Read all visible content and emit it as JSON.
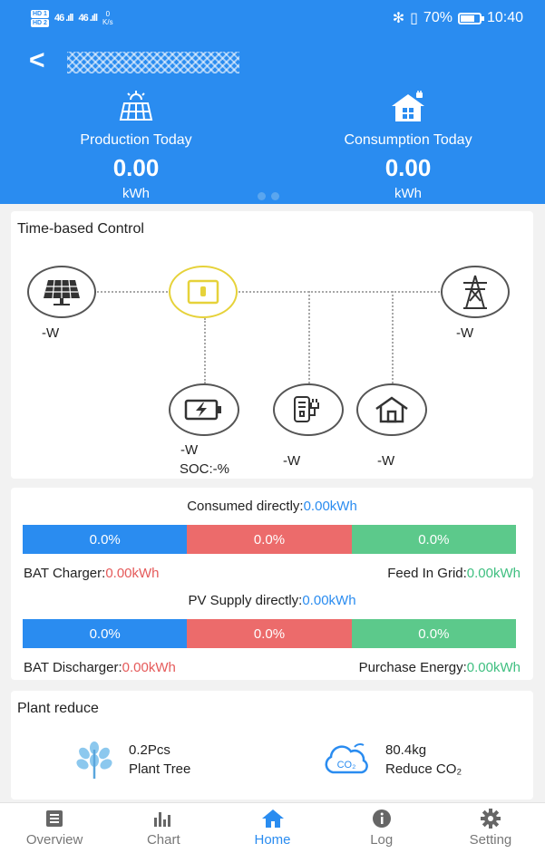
{
  "status_bar": {
    "net1": "HD 1",
    "net2": "HD 2",
    "signal1": "46 .ıll",
    "signal2": "46 .ıll",
    "speed_value": "0",
    "speed_unit": "K/s",
    "battery_pct": "70%",
    "time": "10:40"
  },
  "header": {
    "production": {
      "label": "Production Today",
      "value": "0.00",
      "unit": "kWh"
    },
    "consumption": {
      "label": "Consumption Today",
      "value": "0.00",
      "unit": "kWh"
    }
  },
  "flow": {
    "title": "Time-based Control",
    "pv": "-W",
    "grid": "-W",
    "battery": "-W",
    "soc": "SOC:-%",
    "charger": "-W",
    "home": "-W"
  },
  "energy": {
    "consumed": {
      "label": "Consumed directly:",
      "value": "0.00kWh"
    },
    "bar1": [
      "0.0%",
      "0.0%",
      "0.0%"
    ],
    "bat_charger": {
      "label": "BAT Charger:",
      "value": "0.00kWh"
    },
    "feed_in": {
      "label": "Feed In Grid:",
      "value": "0.00kWh"
    },
    "pv_supply": {
      "label": "PV Supply directly:",
      "value": "0.00kWh"
    },
    "bar2": [
      "0.0%",
      "0.0%",
      "0.0%"
    ],
    "bat_discharger": {
      "label": "BAT Discharger:",
      "value": "0.00kWh"
    },
    "purchase": {
      "label": "Purchase Energy:",
      "value": "0.00kWh"
    }
  },
  "plant_reduce": {
    "title": "Plant reduce",
    "tree_value": "0.2Pcs",
    "tree_label": "Plant Tree",
    "co2_value": "80.4kg",
    "co2_label": "Reduce CO₂",
    "co2_icon_text": "CO₂"
  },
  "nav": [
    {
      "label": "Overview",
      "icon": "overview-icon"
    },
    {
      "label": "Chart",
      "icon": "chart-icon"
    },
    {
      "label": "Home",
      "icon": "home-icon"
    },
    {
      "label": "Log",
      "icon": "info-icon"
    },
    {
      "label": "Setting",
      "icon": "gear-icon"
    }
  ],
  "colors": {
    "primary": "#2a8cf0",
    "red": "#e55a5a",
    "green": "#3fbf80",
    "inverter": "#e6d23a"
  }
}
